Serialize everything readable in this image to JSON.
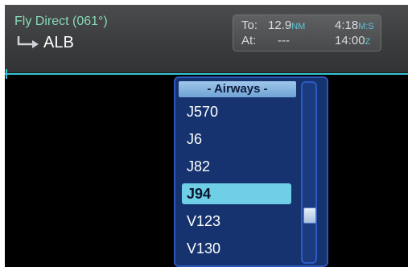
{
  "nav": {
    "title": "Fly Direct (061°)",
    "waypoint": "ALB",
    "to_label": "To:",
    "to_value": "12.9",
    "to_unit": "NM",
    "ete_value": "4:18",
    "ete_unit": "M:S",
    "at_label": "At:",
    "at_value": "---",
    "time_value": "14:00",
    "time_unit": "Z"
  },
  "colors": {
    "accent_cyan": "#33c3d4",
    "header_green": "#86d9b4",
    "dropdown_bg": "#16336f",
    "selected_bg": "#6ecfe6"
  },
  "dropdown": {
    "header": "- Airways -",
    "options": [
      "J570",
      "J6",
      "J82",
      "J94",
      "V123",
      "V130"
    ],
    "selected_index": 3,
    "scroll_position": 0.77
  }
}
